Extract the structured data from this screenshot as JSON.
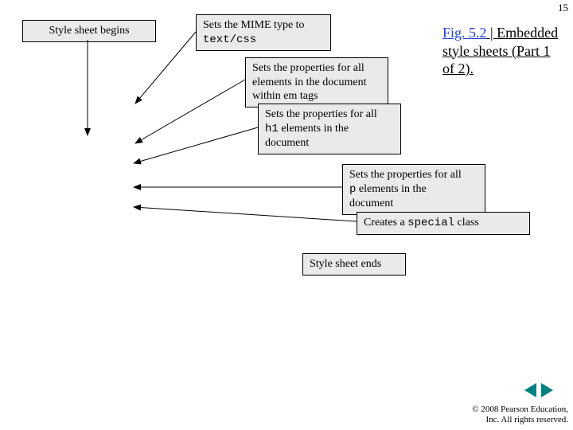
{
  "page_number": "15",
  "callouts": {
    "style_begins": "Style sheet begins",
    "mime_line1": "Sets the MIME type to",
    "mime_code": "text/css",
    "em_props": "Sets the properties for all elements in the document within em tags",
    "h1_props_l1": "Sets the properties for all",
    "h1_props_l2_pre": "h1",
    "h1_props_l2_post": " elements in the",
    "h1_props_l3": "document",
    "p_props_l1": "Sets the properties for all",
    "p_props_l2_pre": "p",
    "p_props_l2_post": " elements in the",
    "p_props_l3": "document",
    "special_pre": "Creates a ",
    "special_code": "special",
    "special_post": " class",
    "style_ends": "Style sheet ends"
  },
  "caption": {
    "fig": "Fig. 5.2",
    "sep": " | ",
    "rest": "Embedded style sheets (Part 1 of 2)."
  },
  "copyright": {
    "line1": "© 2008 Pearson Education,",
    "line2": "Inc.  All rights reserved."
  }
}
